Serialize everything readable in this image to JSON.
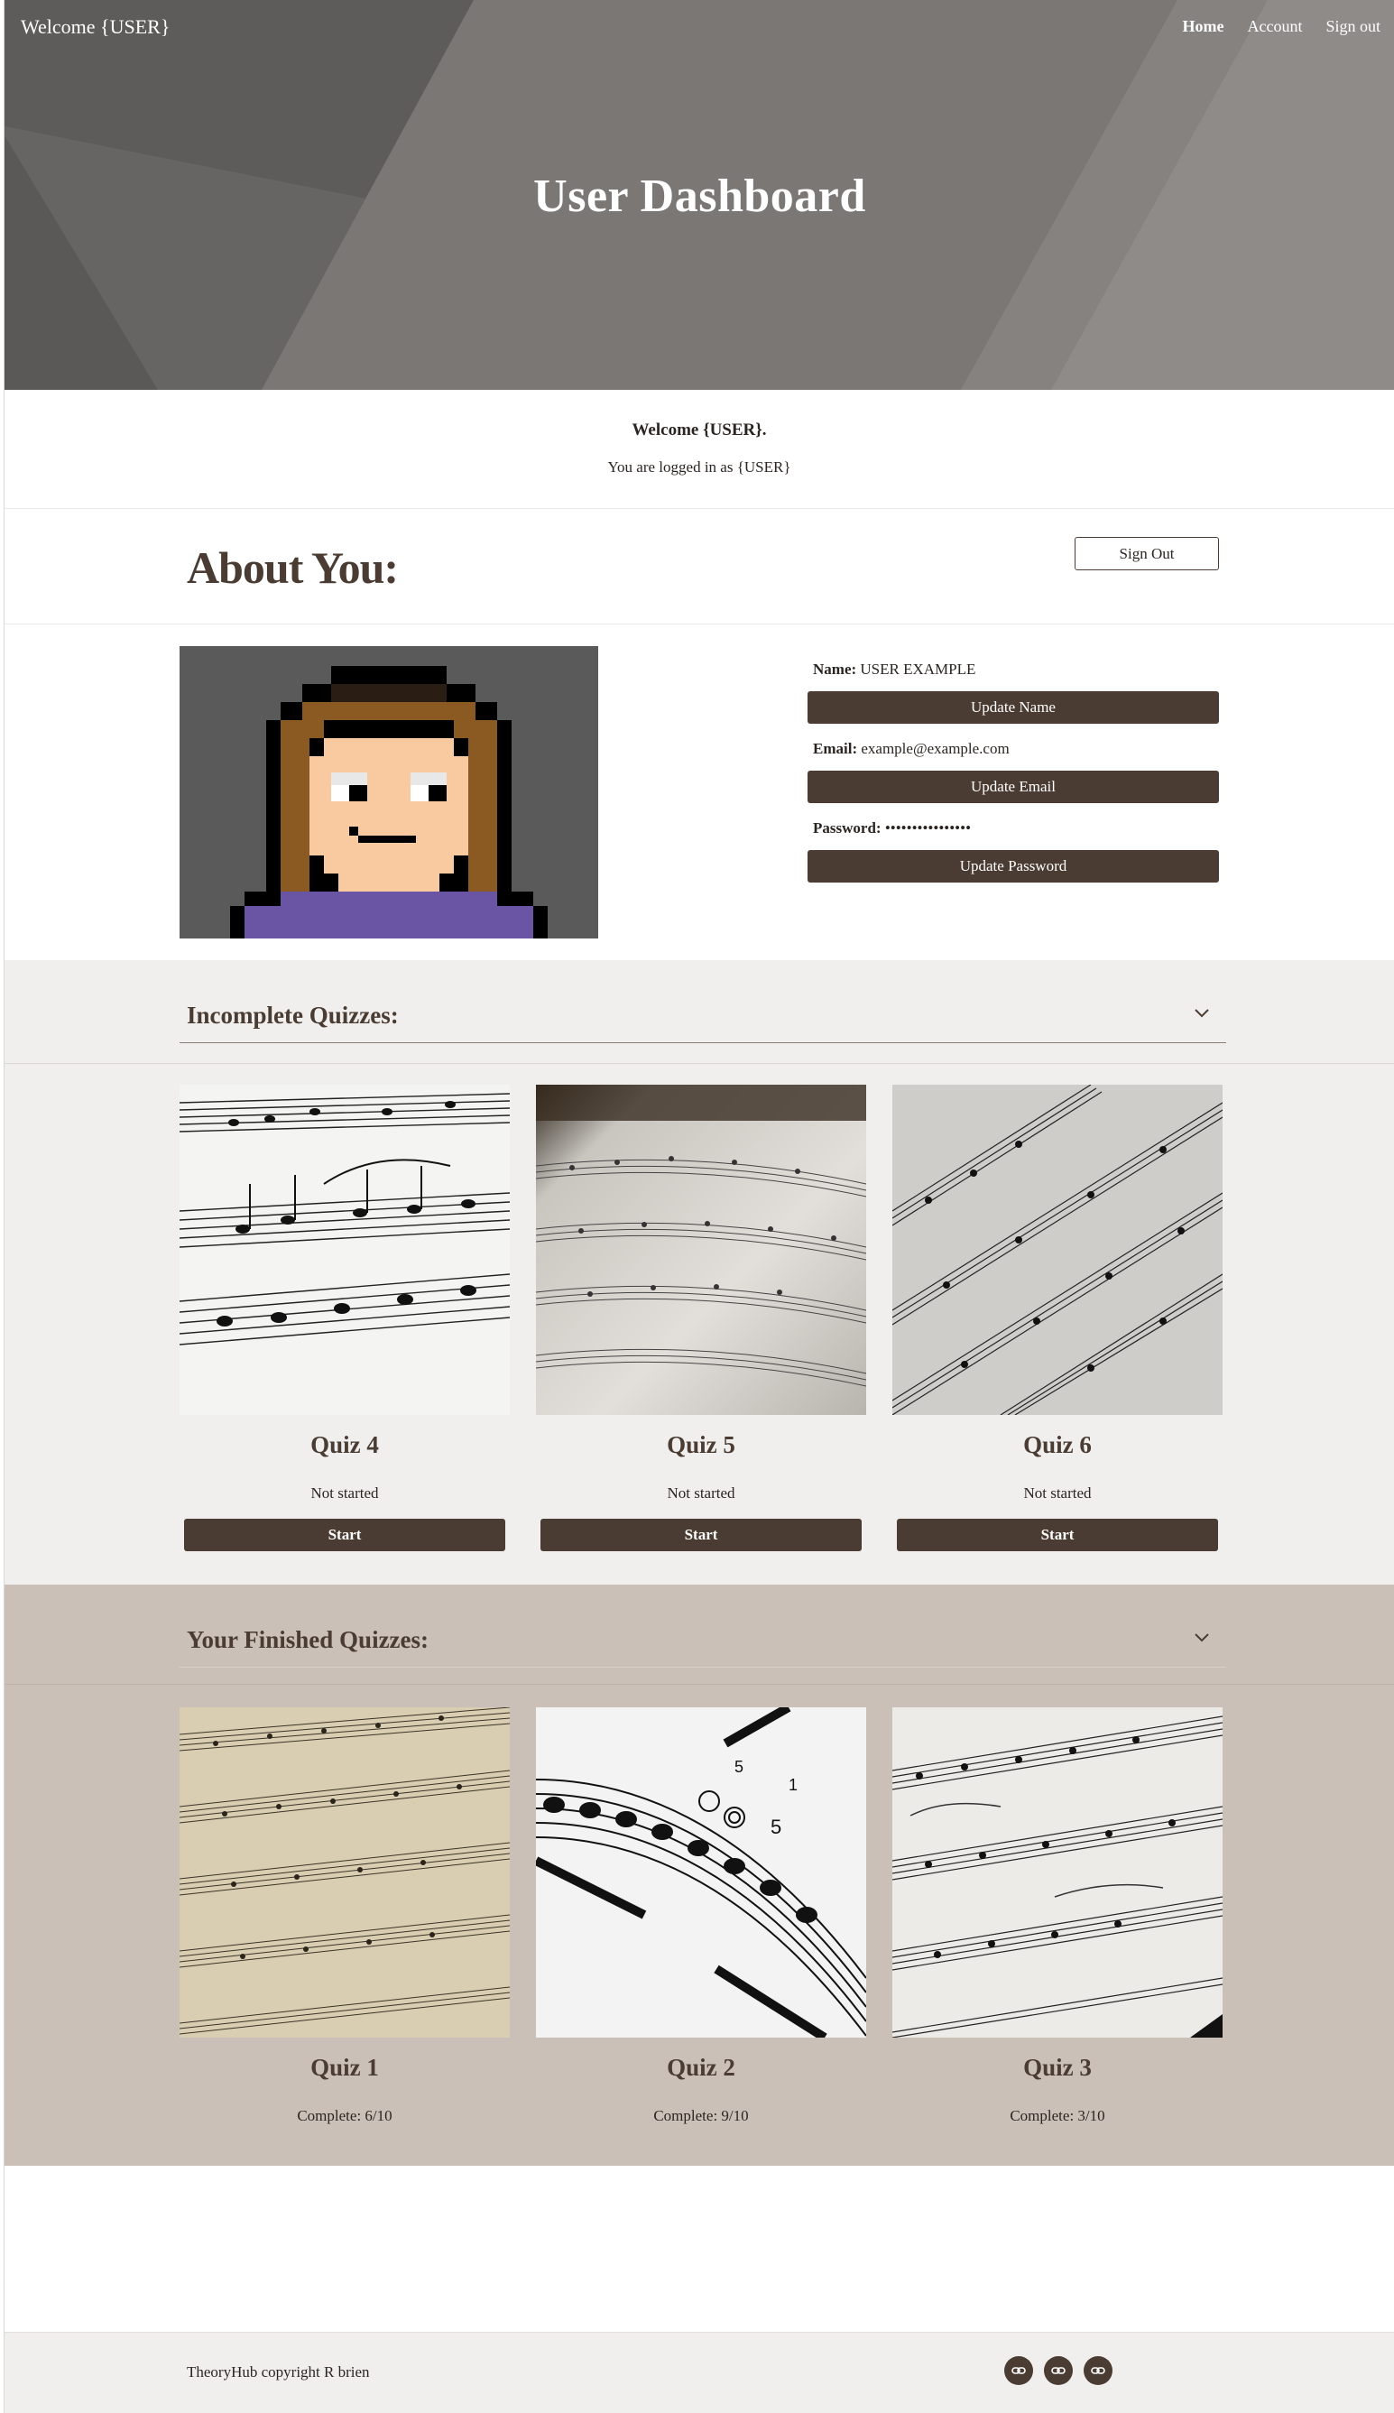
{
  "nav": {
    "brand": "Welcome {USER}",
    "links": [
      "Home",
      "Account",
      "Sign out"
    ]
  },
  "hero": {
    "title": "User Dashboard"
  },
  "welcome": {
    "heading": "Welcome {USER}.",
    "subtext": "You are logged in as {USER}"
  },
  "about": {
    "title": "About You:",
    "sign_out_label": "Sign Out",
    "name_label": "Name:",
    "name_value": "USER EXAMPLE",
    "update_name": "Update Name",
    "email_label": "Email:",
    "email_value": "example@example.com",
    "update_email": "Update Email",
    "password_label": "Password:",
    "password_value": "••••••••••••••••",
    "update_password": "Update Password"
  },
  "incomplete": {
    "title": "Incomplete Quizzes:",
    "quizzes": [
      {
        "title": "Quiz 4",
        "status": "Not started",
        "button": "Start"
      },
      {
        "title": "Quiz 5",
        "status": "Not started",
        "button": "Start"
      },
      {
        "title": "Quiz 6",
        "status": "Not started",
        "button": "Start"
      }
    ]
  },
  "finished": {
    "title": "Your Finished Quizzes:",
    "quizzes": [
      {
        "title": "Quiz 1",
        "status": "Complete: 6/10"
      },
      {
        "title": "Quiz 2",
        "status": "Complete: 9/10"
      },
      {
        "title": "Quiz 3",
        "status": "Complete: 3/10"
      }
    ]
  },
  "footer": {
    "copyright": "TheoryHub copyright R brien",
    "icons": [
      "link-icon",
      "link-icon",
      "link-icon"
    ]
  },
  "colors": {
    "accent": "#4a3c33",
    "section_light": "#f1efed",
    "section_tan": "#cbc0b7"
  }
}
